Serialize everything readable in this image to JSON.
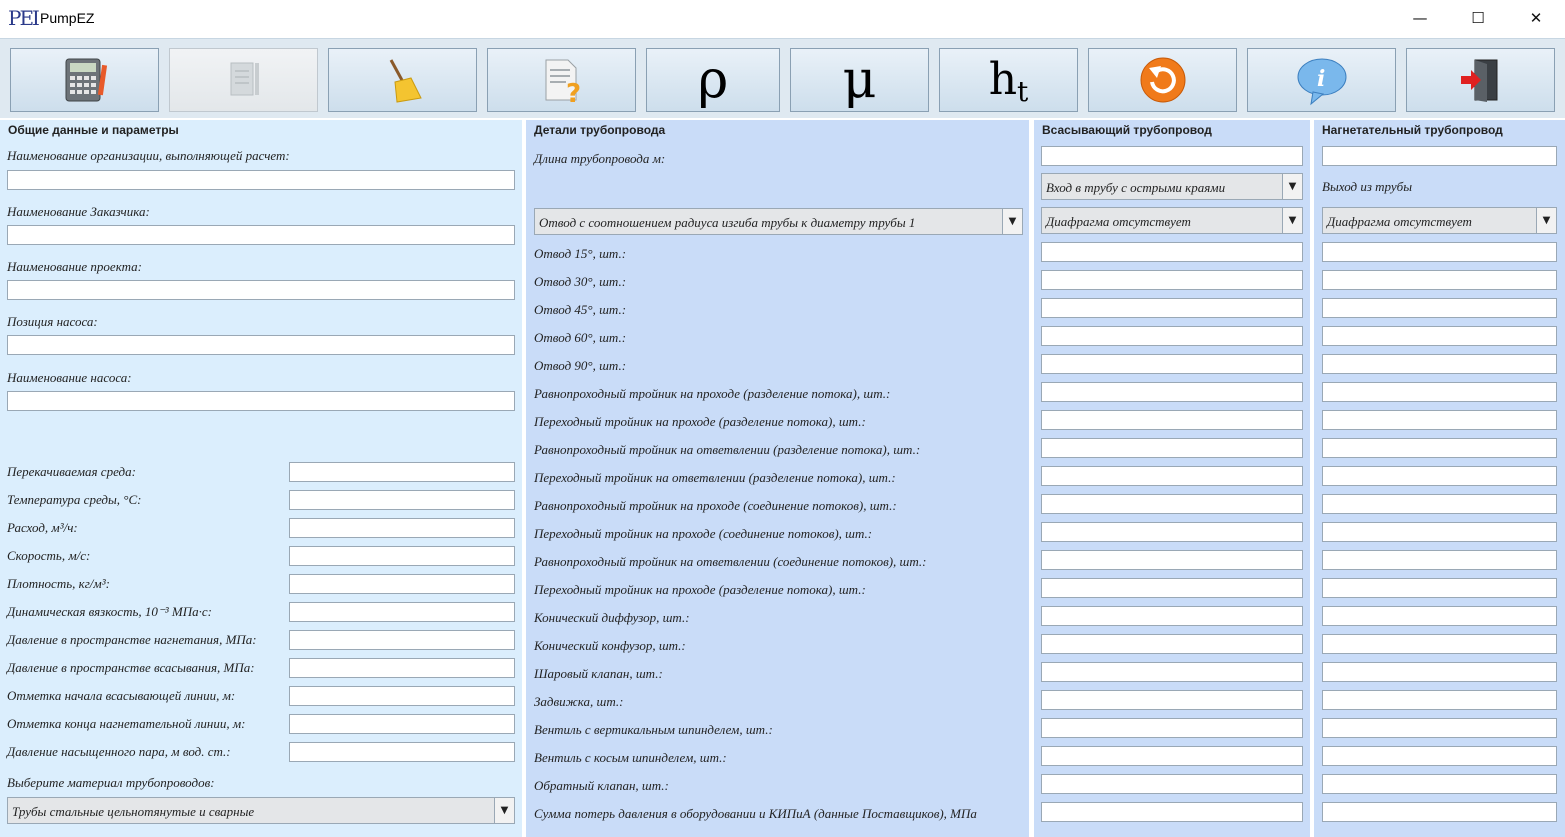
{
  "window": {
    "title": "PumpEZ",
    "icon_text": "PEI",
    "minimize": "—",
    "maximize": "☐",
    "close": "✕"
  },
  "toolbar": {
    "rho": "ρ",
    "mu": "μ",
    "ht_main": "h",
    "ht_sub": "t"
  },
  "general": {
    "legend": "Общие данные и параметры",
    "org_label": "Наименование организации, выполняющей расчет:",
    "customer_label": "Наименование Заказчика:",
    "project_label": "Наименование проекта:",
    "position_label": "Позиция насоса:",
    "pump_label": "Наименование насоса:",
    "params": [
      "Перекачиваемая среда:",
      "Температура среды, °С:",
      "Расход, м³/ч:",
      "Скорость, м/с:",
      "Плотность, кг/м³:",
      "Динамическая вязкость, 10⁻³ МПа·с:",
      "Давление в пространстве нагнетания, МПа:",
      "Давление в пространстве всасывания, МПа:",
      "Отметка начала всасывающей линии, м:",
      "Отметка конца нагнетательной линии, м:",
      "Давление насыщенного пара, м вод. ст.:"
    ],
    "material_label": "Выберите материал трубопроводов:",
    "material_value": "Трубы стальные цельнотянутые и сварные"
  },
  "details": {
    "legend": "Детали трубопровода",
    "length_label": "Длина трубопровода м:",
    "bend_select": "Отвод с соотношением радиуса изгиба трубы к диаметру трубы 1",
    "rows": [
      "Отвод 15°, шт.:",
      "Отвод 30°, шт.:",
      "Отвод 45°, шт.:",
      "Отвод 60°, шт.:",
      "Отвод 90°, шт.:",
      "Равнопроходный тройник на проходе (разделение потока), шт.:",
      "Переходный тройник на проходе (разделение потока), шт.:",
      "Равнопроходный тройник на ответвлении (разделение потока), шт.:",
      "Переходный тройник на ответвлении (разделение потока), шт.:",
      "Равнопроходный тройник на проходе (соединение потоков), шт.:",
      "Переходный тройник на проходе (соединение потоков), шт.:",
      "Равнопроходный тройник на ответвлении (соединение потоков), шт.:",
      "Переходный тройник на проходе (разделение потока), шт.:",
      "Конический диффузор, шт.:",
      "Конический конфузор, шт.:",
      "Шаровый клапан, шт.:",
      "Задвижка, шт.:",
      "Вентиль с вертикальным шпинделем, шт.:",
      "Вентиль с косым шпинделем, шт.:",
      "Обратный клапан, шт.:",
      "Сумма потерь давления в оборудовании и КИПиА (данные Поставщиков), МПа"
    ]
  },
  "suction": {
    "legend": "Всасывающий трубопровод",
    "inlet_select": "Вход в трубу с острыми краями",
    "diaphragm_select": "Диафрагма отсутствует"
  },
  "discharge": {
    "legend": "Нагнетательный трубопровод",
    "outlet_label": "Выход из трубы",
    "diaphragm_select": "Диафрагма отсутствует"
  }
}
